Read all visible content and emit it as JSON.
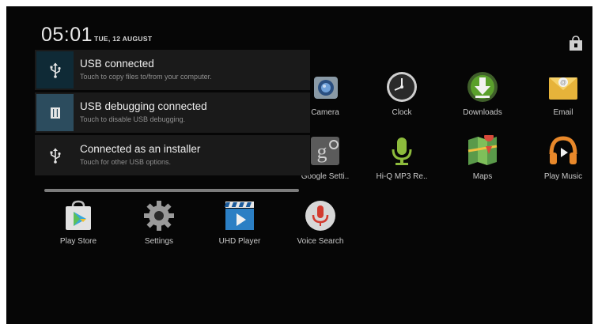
{
  "status": {
    "time": "05:01",
    "date": "TUE, 12 AUGUST",
    "settings_icon": "quick-settings-icon"
  },
  "notifications": [
    {
      "title": "USB connected",
      "subtitle": "Touch to copy files to/from your computer.",
      "icon": "usb-icon"
    },
    {
      "title": "USB debugging connected",
      "subtitle": "Touch to disable USB debugging.",
      "icon": "debug-icon"
    },
    {
      "title": "Connected as an installer",
      "subtitle": "Touch for other USB options.",
      "icon": "usb-icon"
    }
  ],
  "apps": [
    {
      "label": "Camera",
      "icon": "camera-icon"
    },
    {
      "label": "Clock",
      "icon": "clock-icon"
    },
    {
      "label": "Downloads",
      "icon": "downloads-icon"
    },
    {
      "label": "Email",
      "icon": "email-icon"
    },
    {
      "label": "Google Setti..",
      "icon": "google-settings-icon"
    },
    {
      "label": "Hi-Q MP3 Re..",
      "icon": "microphone-icon"
    },
    {
      "label": "Maps",
      "icon": "maps-icon"
    },
    {
      "label": "Play Music",
      "icon": "headphones-icon"
    },
    {
      "label": "Play Store",
      "icon": "play-store-icon"
    },
    {
      "label": "Settings",
      "icon": "settings-gear-icon"
    },
    {
      "label": "UHD Player",
      "icon": "video-player-icon"
    },
    {
      "label": "Voice Search",
      "icon": "voice-search-icon"
    }
  ],
  "colors": {
    "background": "#060606",
    "notification_bg": "#1a1a1a",
    "usb_icon_bg": "#0f2a36",
    "debug_icon_bg": "#2c4c5e",
    "label_text": "#c9c9c9"
  }
}
